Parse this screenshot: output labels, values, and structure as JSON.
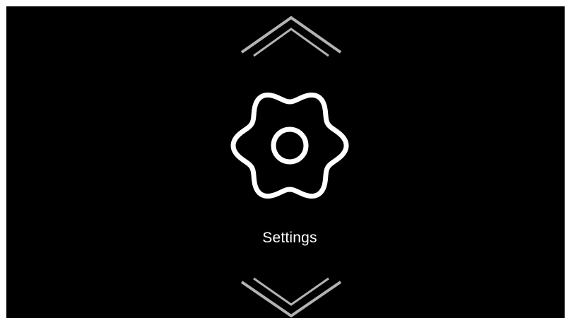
{
  "menu": {
    "current_item_label": "Settings",
    "current_item_icon": "gear-icon",
    "up_icon": "chevron-up-icon",
    "down_icon": "chevron-down-icon"
  },
  "colors": {
    "background": "#000000",
    "icon": "#ffffff",
    "chevron": "#b3b3b3"
  }
}
